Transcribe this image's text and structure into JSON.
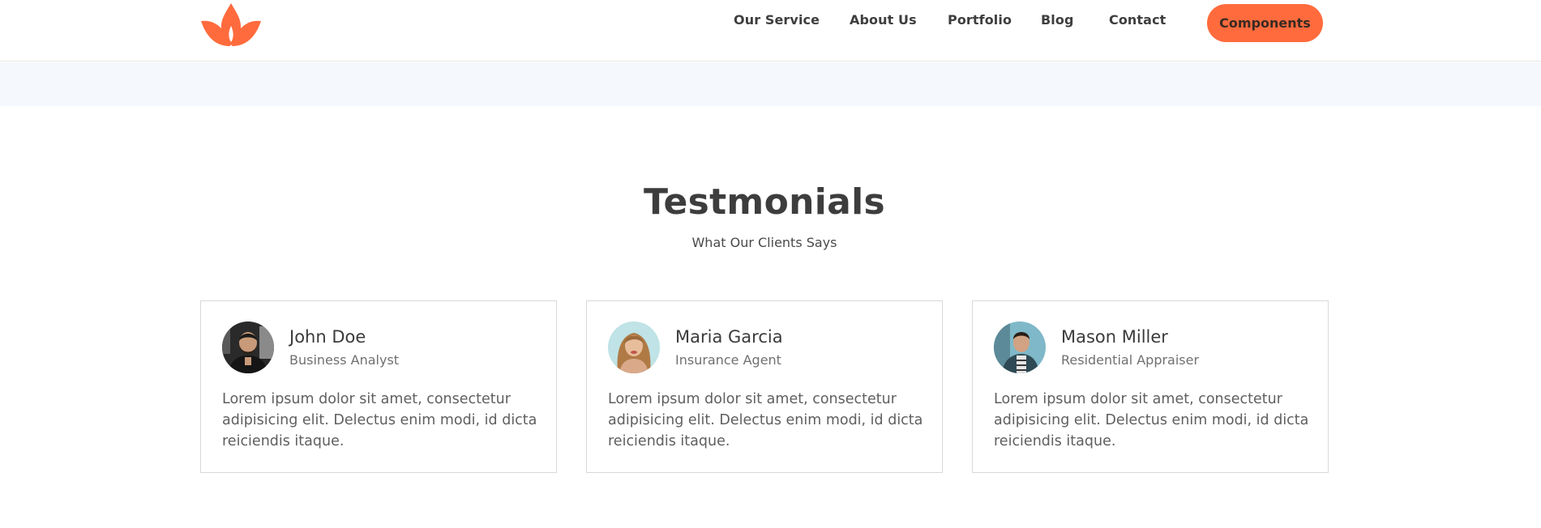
{
  "brand": {
    "logo_icon": "lotus-flame-icon",
    "accent_color": "#ff6b3d"
  },
  "nav": {
    "links": [
      "Our Service",
      "About Us",
      "Portfolio",
      "Blog",
      "Contact"
    ],
    "cta_label": "Components"
  },
  "section": {
    "title": "Testmonials",
    "subtitle": "What Our Clients Says"
  },
  "testimonials": [
    {
      "name": "John Doe",
      "role": "Business Analyst",
      "quote": "Lorem ipsum dolor sit amet, consectetur adipisicing elit. Delectus enim modi, id dicta reiciendis itaque.",
      "avatar_icon": "avatar-john-doe"
    },
    {
      "name": "Maria Garcia",
      "role": "Insurance Agent",
      "quote": "Lorem ipsum dolor sit amet, consectetur adipisicing elit. Delectus enim modi, id dicta reiciendis itaque.",
      "avatar_icon": "avatar-maria-garcia"
    },
    {
      "name": "Mason Miller",
      "role": "Residential Appraiser",
      "quote": "Lorem ipsum dolor sit amet, consectetur adipisicing elit. Delectus enim modi, id dicta reiciendis itaque.",
      "avatar_icon": "avatar-mason-miller"
    }
  ]
}
